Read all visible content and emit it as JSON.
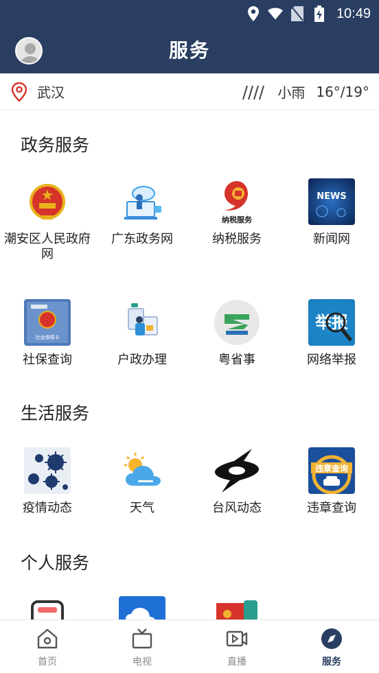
{
  "status": {
    "time": "10:49"
  },
  "header": {
    "title": "服务"
  },
  "location": {
    "city": "武汉",
    "weather": "小雨",
    "temp": "16°/19°"
  },
  "sections": [
    {
      "title": "政务服务",
      "items": [
        {
          "label": "潮安区人民政府网",
          "icon": "national-emblem-icon"
        },
        {
          "label": "广东政务网",
          "icon": "gov-network-icon"
        },
        {
          "label": "纳税服务",
          "icon": "tax-service-icon",
          "logo_text": "纳税服务"
        },
        {
          "label": "新闻网",
          "icon": "news-icon",
          "logo_text": "NEWS"
        },
        {
          "label": "社保查询",
          "icon": "social-security-card-icon",
          "logo_text": "社会保障卡"
        },
        {
          "label": "户政办理",
          "icon": "household-registration-icon"
        },
        {
          "label": "粤省事",
          "icon": "yue-sheng-shi-icon"
        },
        {
          "label": "网络举报",
          "icon": "online-report-icon",
          "logo_text": "举报"
        }
      ]
    },
    {
      "title": "生活服务",
      "items": [
        {
          "label": "疫情动态",
          "icon": "virus-icon"
        },
        {
          "label": "天气",
          "icon": "weather-icon"
        },
        {
          "label": "台风动态",
          "icon": "typhoon-icon"
        },
        {
          "label": "违章查询",
          "icon": "traffic-violation-icon",
          "logo_text": "违章查询"
        }
      ]
    },
    {
      "title": "个人服务",
      "items": [
        {
          "label": "",
          "icon": "device-icon"
        },
        {
          "label": "",
          "icon": "cloud-icon"
        },
        {
          "label": "",
          "icon": "party-icon"
        }
      ]
    }
  ],
  "bottom_nav": [
    {
      "label": "首页",
      "icon": "home-icon"
    },
    {
      "label": "电视",
      "icon": "tv-icon"
    },
    {
      "label": "直播",
      "icon": "live-icon"
    },
    {
      "label": "服务",
      "icon": "compass-icon",
      "active": true
    }
  ],
  "colors": {
    "header_bg": "#2a3e62",
    "accent_red": "#d6332a",
    "nav_active": "#2a3e62",
    "nav_inactive": "#888888"
  }
}
